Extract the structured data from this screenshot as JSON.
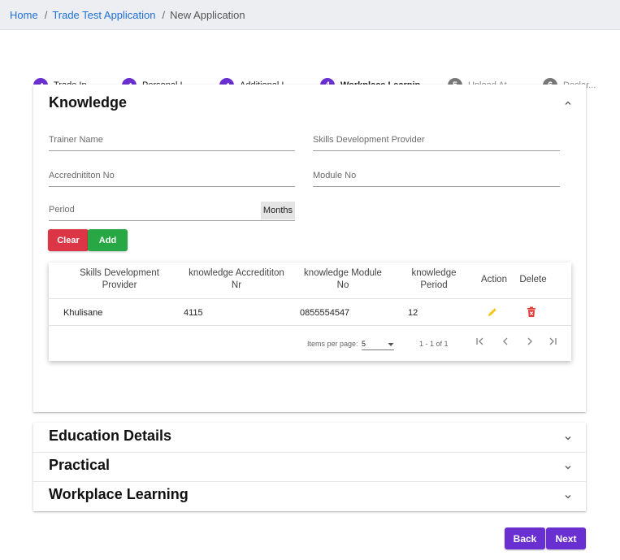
{
  "breadcrumb": {
    "home": "Home",
    "sep1": "/",
    "item1": "Trade Test Application",
    "sep2": "/",
    "current": "New Application"
  },
  "stepper": [
    {
      "num": "",
      "label": "Trade In...",
      "state": "done",
      "icon": "pencil-icon"
    },
    {
      "num": "",
      "label": "Personal I...",
      "state": "done",
      "icon": "pencil-icon"
    },
    {
      "num": "",
      "label": "Additional I...",
      "state": "done",
      "icon": "pencil-icon"
    },
    {
      "num": "4",
      "label": "Workplace Learnin...",
      "state": "active"
    },
    {
      "num": "5",
      "label": "Upload At...",
      "state": "todo"
    },
    {
      "num": "6",
      "label": "Declar...",
      "state": "todo"
    }
  ],
  "knowledge": {
    "title": "Knowledge",
    "fields": {
      "trainer_name": "Trainer Name",
      "skills_provider": "Skills Development Provider",
      "accreditation_no": "Accrednititon No",
      "module_no": "Module No",
      "period": "Period",
      "period_suffix": "Months"
    },
    "clear_label": "Clear",
    "add_label": "Add",
    "table": {
      "headers": [
        "Skills Development Provider",
        "knowledge Accredititon Nr",
        "knowledge Module No",
        "knowledge Period",
        "Action",
        "Delete"
      ],
      "rows": [
        [
          "Khulisane",
          "4115",
          "0855554547",
          "12"
        ]
      ],
      "items_per_page_label": "Items per page:",
      "items_per_page_value": "5",
      "range": "1 - 1 of 1"
    }
  },
  "sections": [
    "Education Details",
    "Practical",
    "Workplace Learning"
  ],
  "nav": {
    "back": "Back",
    "next": "Next"
  },
  "colors": {
    "primary": "#6a2fd0",
    "clear": "#dc3545",
    "add": "#28a745",
    "edit": "#f5c518",
    "delete": "#e53935"
  }
}
